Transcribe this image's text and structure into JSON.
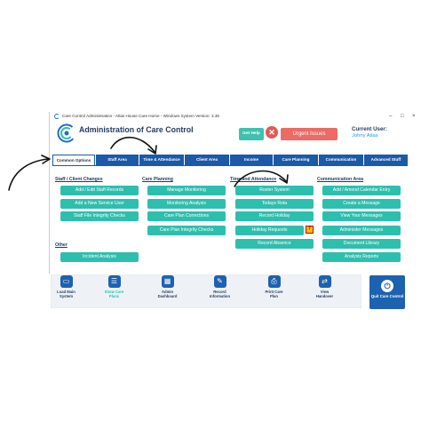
{
  "window": {
    "title": "Care Control Administration - Atlas House Care Home - Windows System Version: 3.35"
  },
  "header": {
    "title": "Administration of Care Control",
    "get_help": "Get Help",
    "close_icon": "x-icon",
    "urgent_issues": "Urgent Issues",
    "current_user_label": "Current User:",
    "current_user_name": "Johny Atlas"
  },
  "tabs": [
    {
      "label": "Common Options",
      "active": true
    },
    {
      "label": "Staff Area",
      "active": false
    },
    {
      "label": "Time & Attendance",
      "active": false
    },
    {
      "label": "Client Area",
      "active": false
    },
    {
      "label": "Income",
      "active": false
    },
    {
      "label": "Care Planning",
      "active": false
    },
    {
      "label": "Communication",
      "active": false
    },
    {
      "label": "Advanced Stuff",
      "active": false
    }
  ],
  "sections": {
    "staff_client": {
      "heading": "Staff / Client Changes",
      "buttons": [
        "Add / Edit Staff Records",
        "Add a New Service User",
        "Staff File Integrity Checks"
      ]
    },
    "other": {
      "heading": "Other",
      "buttons": [
        "Incident Analysis"
      ]
    },
    "care_planning": {
      "heading": "Care Planning",
      "buttons": [
        "Manage Monitoring",
        "Monitoring Analysis",
        "Care Plan Corrections",
        "Care Plan Integrity Checks"
      ]
    },
    "time_attendance": {
      "heading": "Time and Attendance",
      "buttons": [
        "Roster System",
        "Todays Rota",
        "Record Holiday",
        "Holiday Requests",
        "Record Absence"
      ],
      "holiday_requests_badge": "7"
    },
    "communication": {
      "heading": "Communication Area",
      "buttons": [
        "Add / Amend Calendar Entry",
        "Create a Message",
        "View Your Messages",
        "Administer Messages",
        "Document Library",
        "Analysis Reports"
      ]
    }
  },
  "footer": {
    "buttons": [
      {
        "label": "Load Main System",
        "icon": "monitor-icon"
      },
      {
        "label": "Show Care Plans",
        "icon": "care-plan-icon"
      },
      {
        "label": "Admin Dashboard",
        "icon": "dashboard-icon"
      },
      {
        "label": "Record Information",
        "icon": "record-icon"
      },
      {
        "label": "Print Care Plan",
        "icon": "printer-icon"
      },
      {
        "label": "View Handover",
        "icon": "handover-icon"
      }
    ],
    "quit": {
      "label": "Quit Care Control",
      "icon": "power-icon"
    }
  },
  "colors": {
    "teal_button": "#2dbfae",
    "tab_blue": "#1a5aa8",
    "urgent_red": "#ec6b65",
    "title_navy": "#1f3a5f",
    "user_name_blue": "#1b9fd1"
  }
}
